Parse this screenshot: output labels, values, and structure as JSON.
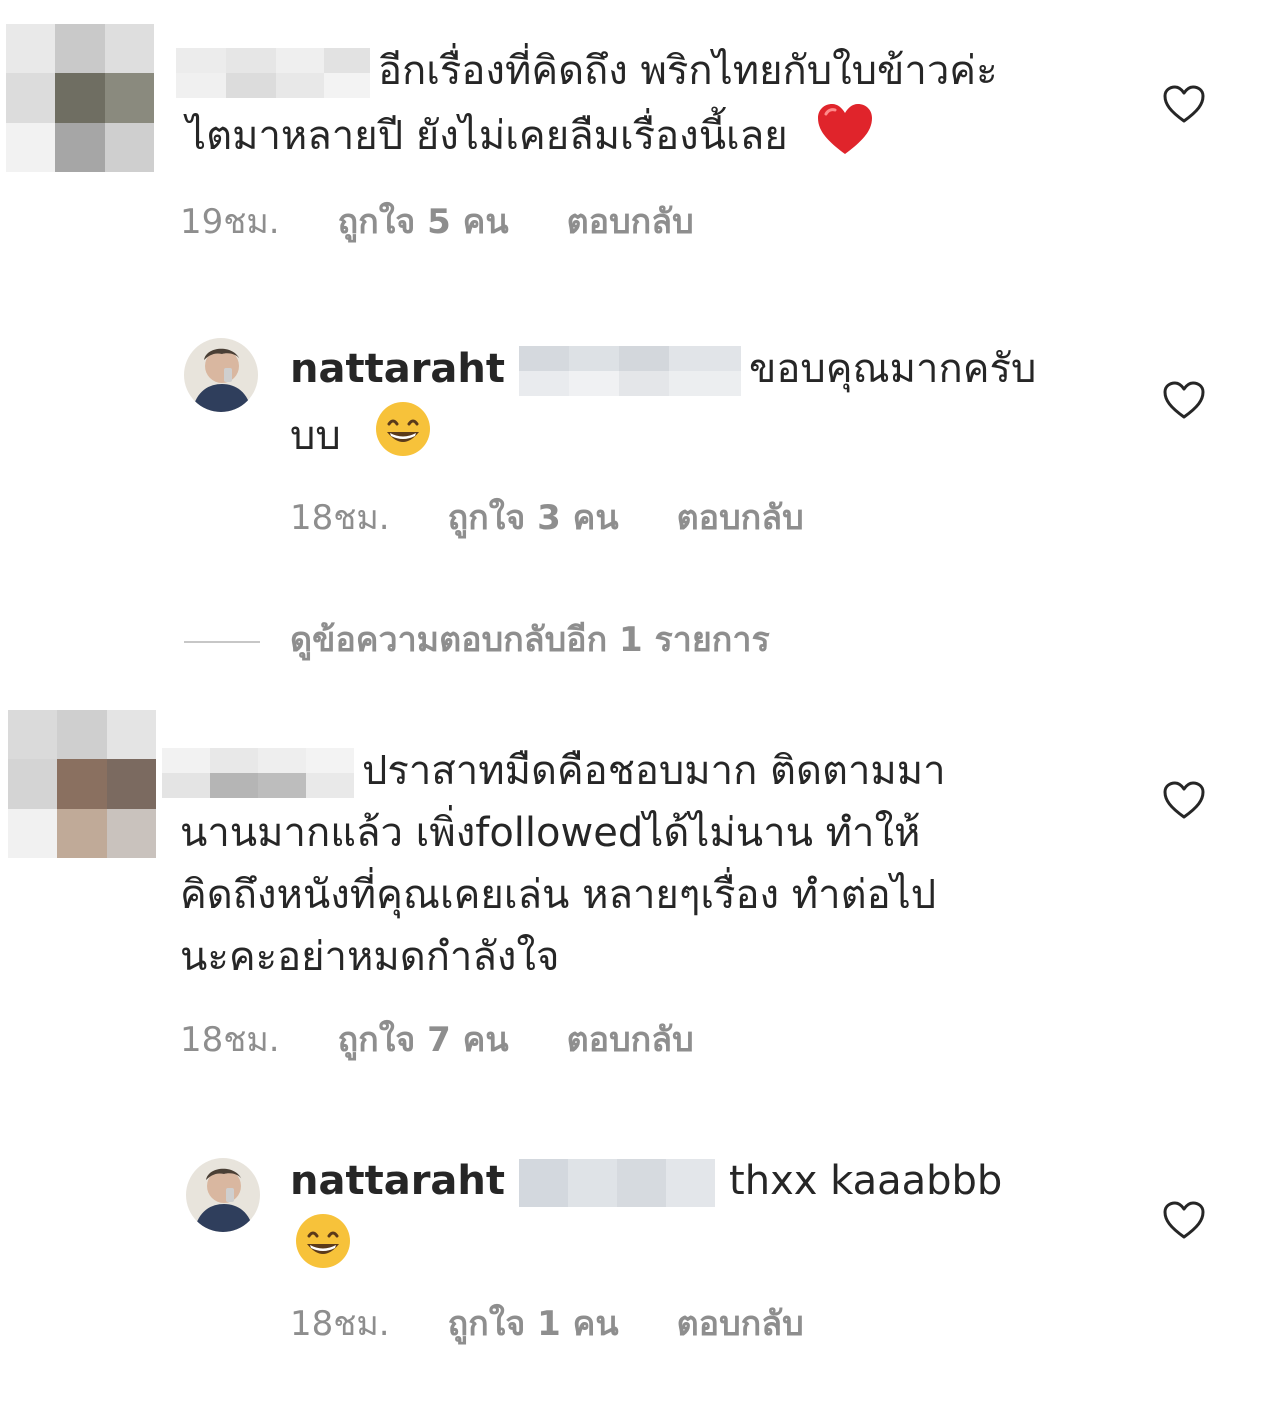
{
  "comments": [
    {
      "text_line1": "อีกเรื่องที่คิดถึง พริกไทยกับใบข้าวค่ะ",
      "text_line2": "ไตมาหลายปี ยังไม่เคยลืมเรื่องนี้เลย",
      "emoji": "heart-emoji",
      "time": "19ชม.",
      "likes": "ถูกใจ 5 คน",
      "reply": "ตอบกลับ"
    },
    {
      "username": "nattaraht",
      "text_line1": "ขอบคุณมากครับ",
      "text_line2": "บบ",
      "emoji": "grinning-face-emoji",
      "time": "18ชม.",
      "likes": "ถูกใจ 3 คน",
      "reply": "ตอบกลับ"
    },
    {
      "text_line1": "ปราสาทมืดคือชอบมาก ติดตามมา",
      "text_line2": "นานมากแล้ว เพิ่งfollowedได้ไม่นาน ทำให้",
      "text_line3": "คิดถึงหนังที่คุณเคยเล่น หลายๆเรื่อง ทำต่อไป",
      "text_line4": "นะคะอย่าหมดกำลังใจ",
      "time": "18ชม.",
      "likes": "ถูกใจ 7 คน",
      "reply": "ตอบกลับ"
    },
    {
      "username": "nattaraht",
      "text_line1": "thxx kaaabbb",
      "emoji": "grinning-face-emoji",
      "time": "18ชม.",
      "likes": "ถูกใจ 1 คน",
      "reply": "ตอบกลับ"
    }
  ],
  "view_replies": "ดูข้อความตอบกลับอีก 1 รายการ",
  "icons": {
    "like": "heart-outline-icon"
  },
  "colors": {
    "text": "#262626",
    "meta": "#8e8e8e",
    "heart_emoji": "#e0242b",
    "emoji_face": "#f7c23a"
  }
}
